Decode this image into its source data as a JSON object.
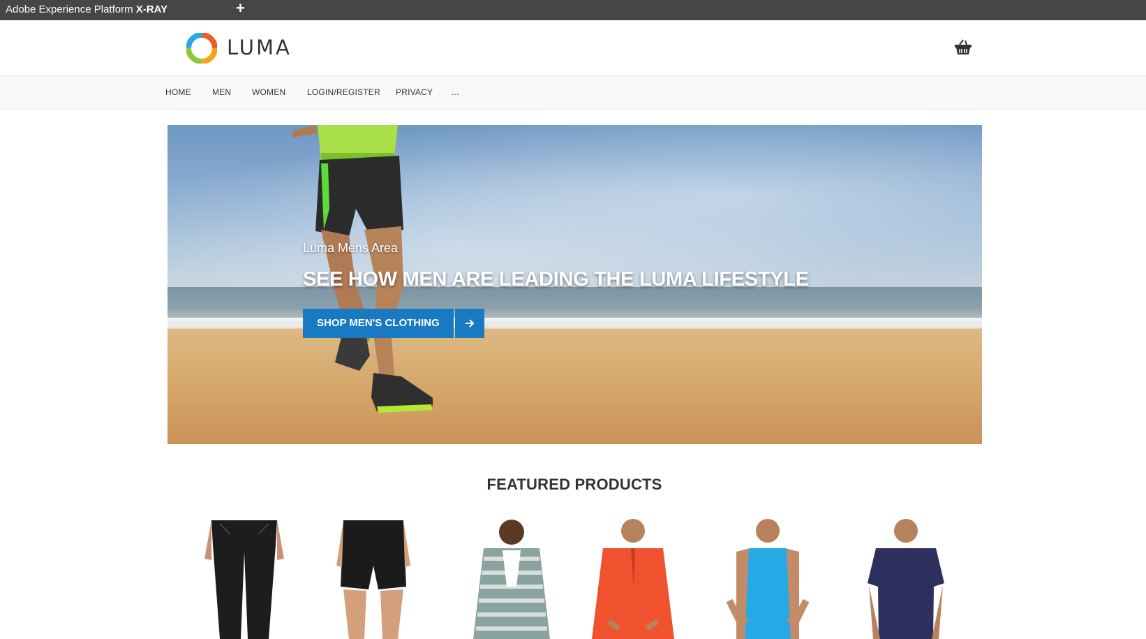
{
  "xray": {
    "title_prefix": "Adobe Experience Platform ",
    "title_bold": "X-RAY",
    "add_label": "+"
  },
  "header": {
    "logo_text": "LUMA",
    "cart_icon": "shopping-basket-icon"
  },
  "nav": {
    "items": [
      {
        "label": "HOME"
      },
      {
        "label": "MEN"
      },
      {
        "label": "WOMEN"
      },
      {
        "label": "LOGIN/REGISTER"
      },
      {
        "label": "PRIVACY"
      },
      {
        "label": "..."
      }
    ]
  },
  "hero": {
    "subtitle": "Luma Mens Area",
    "title": "SEE HOW MEN ARE LEADING THE LUMA LIFESTYLE",
    "cta_label": "SHOP MEN'S CLOTHING",
    "cta_icon": "arrow-right-icon",
    "accent_color": "#1979c3"
  },
  "featured": {
    "title": "FEATURED PRODUCTS",
    "products": [
      {
        "kind": "black pants"
      },
      {
        "kind": "black shorts"
      },
      {
        "kind": "striped hoodie"
      },
      {
        "kind": "orange pullover"
      },
      {
        "kind": "blue tank top"
      },
      {
        "kind": "navy tee"
      }
    ]
  }
}
